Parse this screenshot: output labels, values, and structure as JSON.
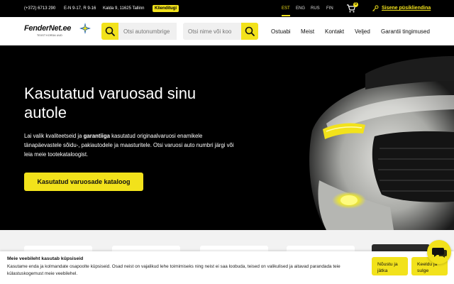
{
  "topbar": {
    "phone": "(+372) 6713 290",
    "hours": "E-N 9-17, R 9-16",
    "address": "Kalda 9, 11625 Tallinn",
    "badge": "Klienditugi",
    "languages": [
      "EST",
      "ENG",
      "RUS",
      "FIN"
    ],
    "active_language": "EST",
    "cart_count": "0",
    "login": "Sisene püsikliendina"
  },
  "header": {
    "logo": "FenderNet.ee",
    "logo_tagline": "TEXST KORDA UUD",
    "search_plate_placeholder": "Otsi autonumbrige",
    "search_name_placeholder": "Otsi nime või koo",
    "nav": [
      "Ostuabi",
      "Meist",
      "Kontakt",
      "Veljed",
      "Garantii tingimused"
    ]
  },
  "hero": {
    "title": "Kasutatud varuosad sinu autole",
    "desc_pre": "Lai valik kvaliteetseid ja ",
    "desc_bold": "garantiiga",
    "desc_post": " kasutatud originaalvaruosi enamikele tänapäevastele sõidu-, pakiautodele ja maasturitele. Otsi varuosi auto numbri järgi või leia meie tootekataloogist.",
    "cta": "Kasutatud varuosade kataloog"
  },
  "cookie": {
    "title": "Meie veebileht kasutab küpsiseid",
    "text": "Kasutame enda ja kolmandate osapoolte küpsiseid. Osad neist on vajalikud lehe toimimiseks ning neist ei saa loobuda, teised on valikulised ja aitavad parandada teie külastuskogemust meie veebilehel.",
    "accept": "Nõustu ja jätka",
    "decline": "Keeldu ja sulge"
  },
  "colors": {
    "accent": "#f2e21b",
    "dark": "#000000"
  },
  "icons": {
    "cart": "cart-icon",
    "key": "key-icon",
    "search": "search-icon",
    "chat": "chat-icon"
  }
}
